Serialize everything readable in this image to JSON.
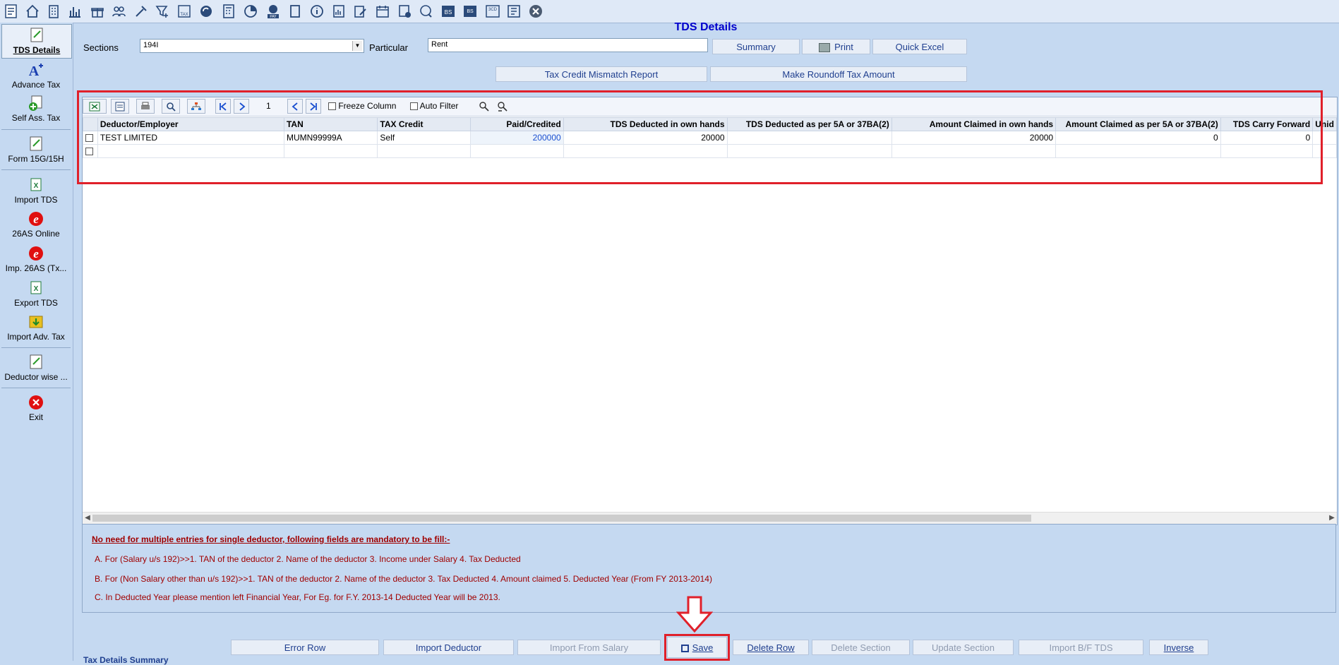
{
  "toolbar": {
    "icons": [
      "tds-icon",
      "home-icon",
      "building-icon",
      "bar-chart-icon",
      "gift-icon",
      "users-icon",
      "tools-icon",
      "filter-icon",
      "tax-icon",
      "refresh-icon",
      "calculator-icon",
      "pie-chart-icon",
      "pay-icon",
      "book-icon",
      "info-icon",
      "report-icon",
      "edit-icon",
      "calendar-icon",
      "add-icon",
      "chat-icon",
      "bs-icon",
      "bs-schedule-icon",
      "3cd-icon",
      "form-icon",
      "close-icon"
    ],
    "labels": {
      "tax": "TAX",
      "pay": "PAY",
      "bs": "BS",
      "bs2": "BS",
      "threecd": "3CD"
    }
  },
  "sidebar": {
    "items": [
      {
        "label": "TDS Details"
      },
      {
        "label": "Advance Tax"
      },
      {
        "label": "Self Ass. Tax"
      },
      {
        "label": "Form 15G/15H"
      },
      {
        "label": "Import TDS"
      },
      {
        "label": "26AS Online"
      },
      {
        "label": "Imp. 26AS (Tx..."
      },
      {
        "label": "Export TDS"
      },
      {
        "label": "Import Adv. Tax"
      },
      {
        "label": "Deductor wise ..."
      },
      {
        "label": "Exit"
      }
    ]
  },
  "page": {
    "title": "TDS Details"
  },
  "form": {
    "sections_label": "Sections",
    "sections_value": "194I",
    "particular_label": "Particular",
    "particular_value": "Rent"
  },
  "buttons": {
    "summary": "Summary",
    "print": "Print",
    "quick_excel": "Quick Excel",
    "mismatch": "Tax Credit Mismatch Report",
    "roundoff": "Make Roundoff Tax Amount"
  },
  "grid": {
    "page_no": "1",
    "freeze_column": "Freeze Column",
    "auto_filter": "Auto Filter",
    "columns": [
      "Deductor/Employer",
      "TAN",
      "TAX Credit",
      "Paid/Credited",
      "TDS Deducted in own hands",
      "TDS Deducted as per 5A or 37BA(2)",
      "Amount Claimed in own hands",
      "Amount Claimed as per 5A or 37BA(2)",
      "TDS Carry Forward",
      "Unid"
    ],
    "rows": [
      [
        "TEST LIMITED",
        "MUMN99999A",
        "Self",
        "200000",
        "20000",
        "",
        "20000",
        "0",
        "0",
        ""
      ],
      [
        "",
        "",
        "",
        "",
        "",
        "",
        "",
        "",
        "",
        ""
      ]
    ]
  },
  "notes": {
    "heading": "No need for multiple entries for single deductor, following fields are mandatory to be fill:-",
    "lines": [
      "A. For (Salary u/s 192)>>1. TAN of the deductor 2. Name of the deductor 3. Income under Salary 4. Tax Deducted",
      "B. For (Non Salary other than u/s 192)>>1. TAN of the deductor 2. Name of the deductor 3. Tax Deducted 4. Amount claimed 5. Deducted Year (From FY 2013-2014)",
      "C. In Deducted Year please mention left Financial Year, For Eg. for F.Y. 2013-14 Deducted Year will be 2013."
    ]
  },
  "actions": {
    "error_row": "Error Row",
    "import_deductor": "Import Deductor",
    "import_salary": "Import From Salary",
    "save": "Save",
    "delete_row": "Delete Row",
    "delete_section": "Delete Section",
    "update_section": "Update Section",
    "import_bf": "Import B/F TDS",
    "inverse": "Inverse"
  },
  "footer": {
    "summary_label": "Tax Details Summary"
  }
}
